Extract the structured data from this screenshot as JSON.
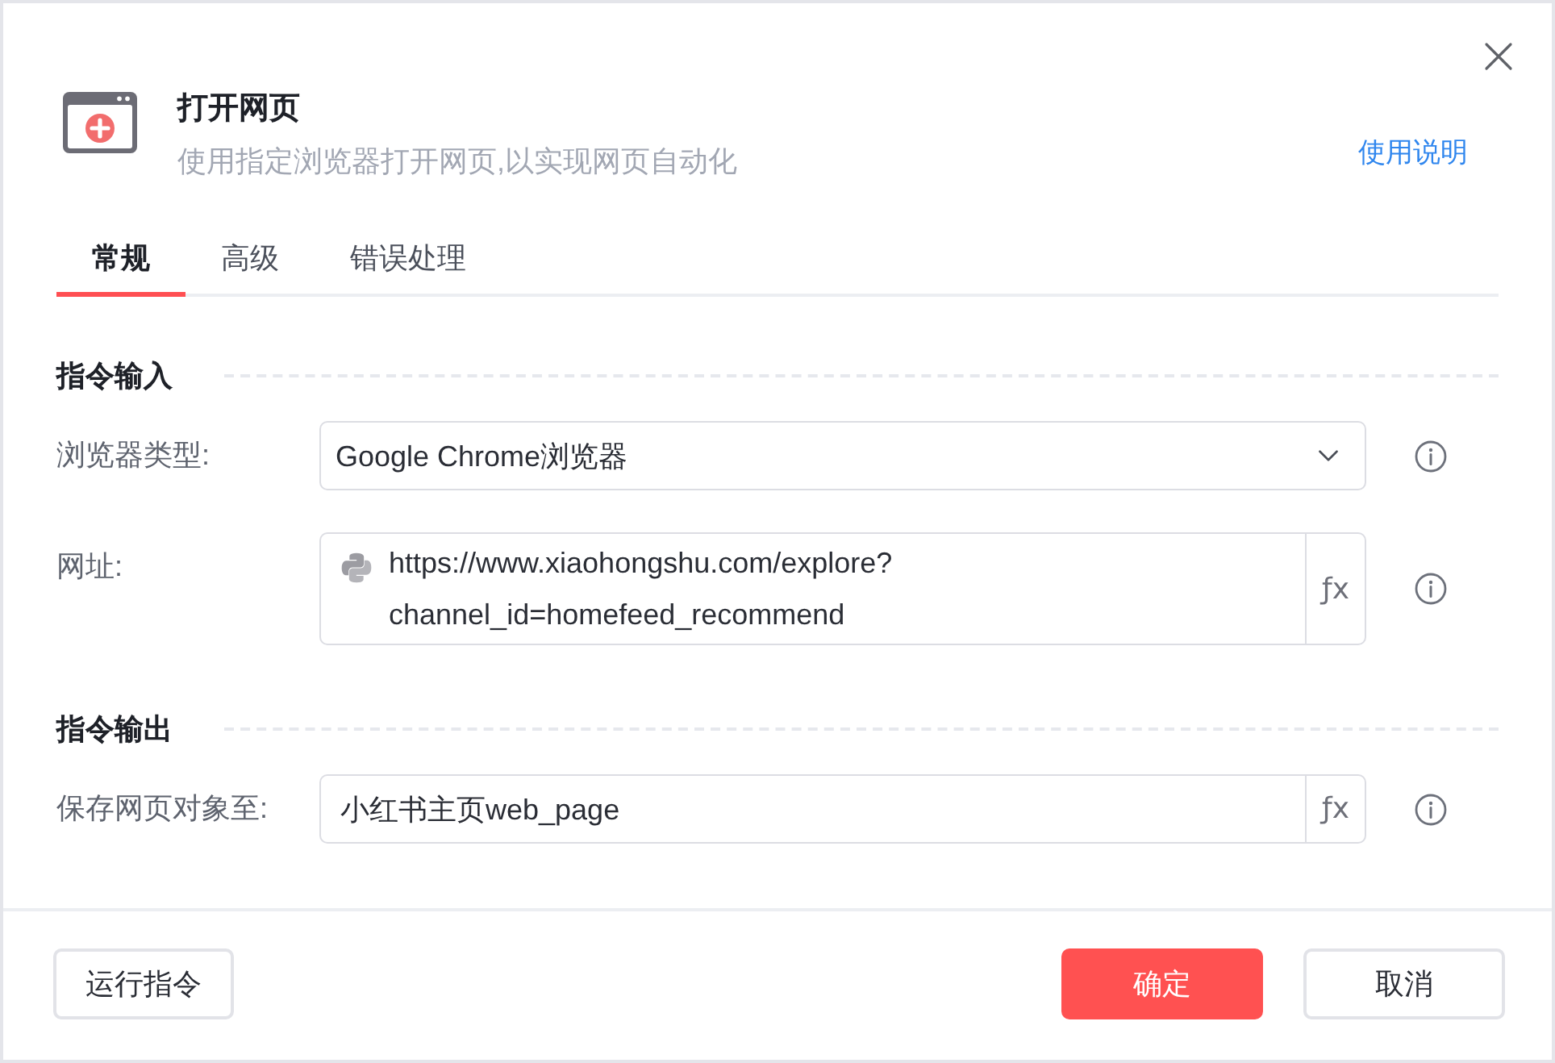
{
  "dialog": {
    "title": "打开网页",
    "subtitle": "使用指定浏览器打开网页,以实现网页自动化",
    "help_link": "使用说明"
  },
  "tabs": [
    {
      "label": "常规",
      "selected": true
    },
    {
      "label": "高级",
      "selected": false
    },
    {
      "label": "错误处理",
      "selected": false
    }
  ],
  "sections": [
    {
      "title": "指令输入",
      "fields": [
        {
          "kind": "select",
          "label": "浏览器类型:",
          "value": "Google Chrome浏览器"
        },
        {
          "kind": "expression",
          "label": "网址:",
          "value": "https://www.xiaohongshu.com/explore?channel_id=homefeed_recommend",
          "python_mode": true,
          "action": "ƒx"
        }
      ]
    },
    {
      "title": "指令输出",
      "fields": [
        {
          "kind": "expression",
          "label": "保存网页对象至:",
          "value": "小红书主页web_page",
          "python_mode": false,
          "action": "ƒx"
        }
      ]
    }
  ],
  "footer": {
    "run_button": "运行指令",
    "confirm_button": "确定",
    "cancel_button": "取消"
  }
}
